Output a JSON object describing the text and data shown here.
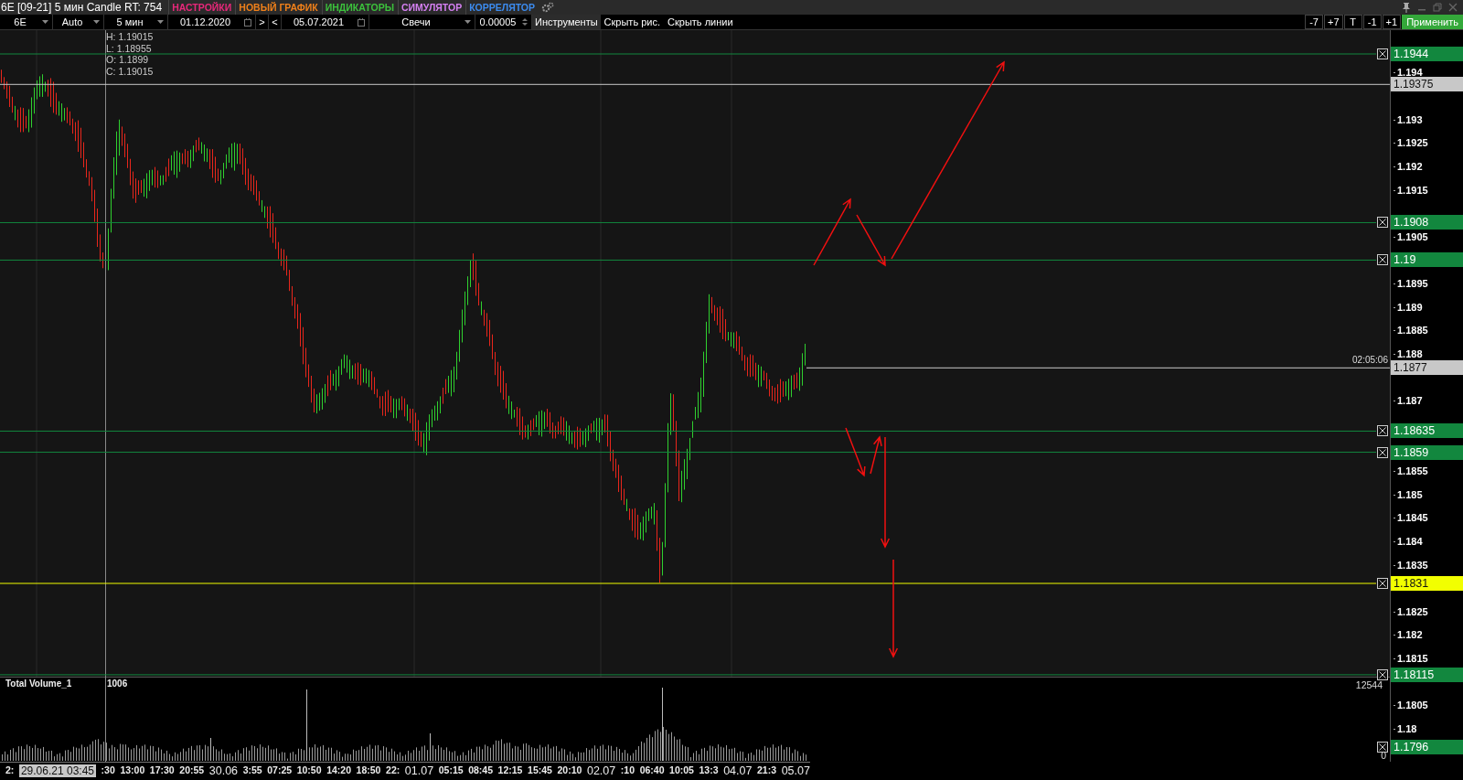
{
  "title_bar": {
    "title": "6E [09-21] 5 мин Candle RT: 754",
    "menu": [
      {
        "label": "НАСТРОЙКИ",
        "color": "#e8287a"
      },
      {
        "label": "НОВЫЙ ГРАФИК",
        "color": "#f0801a"
      },
      {
        "label": "ИНДИКАТОРЫ",
        "color": "#3cc23c"
      },
      {
        "label": "СИМУЛЯТОР",
        "color": "#d580f2"
      },
      {
        "label": "КОРРЕЛЯТОР",
        "color": "#3c8cf0"
      }
    ]
  },
  "toolbar": {
    "controls": [
      {
        "kind": "select",
        "value": "6E"
      },
      {
        "kind": "select",
        "value": "Auto"
      },
      {
        "kind": "select",
        "value": "5 мин"
      },
      {
        "kind": "date",
        "value": "01.12.2020"
      },
      {
        "kind": "button",
        "value": ">"
      },
      {
        "kind": "button",
        "value": "<"
      },
      {
        "kind": "date",
        "value": "05.07.2021"
      },
      {
        "kind": "select",
        "value": "Свечи"
      },
      {
        "kind": "spinner",
        "value": "0.00005"
      },
      {
        "kind": "tool",
        "value": "Инструменты"
      },
      {
        "kind": "link",
        "value": "Скрыть рис."
      },
      {
        "kind": "link",
        "value": "Скрыть линии"
      }
    ],
    "right_buttons": [
      {
        "label": "-7",
        "kind": "plain"
      },
      {
        "label": "+7",
        "kind": "plain"
      },
      {
        "label": "T",
        "kind": "plain"
      },
      {
        "label": "-1",
        "kind": "plain"
      },
      {
        "label": "+1",
        "kind": "plain"
      },
      {
        "label": "Применить",
        "kind": "apply"
      }
    ]
  },
  "chart": {
    "ohlc": [
      "H: 1.19015",
      "L: 1.18955",
      "O: 1.1899",
      "C: 1.19015"
    ],
    "levels": [
      {
        "price": "1.1944",
        "color": "#12873e",
        "closable": true
      },
      {
        "price": "1.19375",
        "color": "#c8c8c8",
        "closable": false
      },
      {
        "price": "1.1908",
        "color": "#12873e",
        "closable": true
      },
      {
        "price": "1.19",
        "color": "#12873e",
        "closable": true
      },
      {
        "price": "1.1877",
        "color": "#c8c8c8",
        "closable": false,
        "time": "02:05:06"
      },
      {
        "price": "1.18635",
        "color": "#12873e",
        "closable": true
      },
      {
        "price": "1.1859",
        "color": "#12873e",
        "closable": true
      },
      {
        "price": "1.1831",
        "color": "#f2ff00",
        "closable": true
      },
      {
        "price": "1.18115",
        "color": "#12873e",
        "closable": true
      },
      {
        "price": "1.1796",
        "color": "#12873e",
        "closable": true
      }
    ],
    "price_ticks": [
      "1.194",
      "1.193",
      "1.1925",
      "1.192",
      "1.1915",
      "1.1905",
      "1.1895",
      "1.189",
      "1.1885",
      "1.188",
      "1.187",
      "1.1855",
      "1.185",
      "1.1845",
      "1.184",
      "1.1835",
      "1.1825",
      "1.182",
      "1.1815",
      "1.1805",
      "1.18"
    ]
  },
  "volume_panel": {
    "title": "Total Volume_1",
    "cursor_value": "1006",
    "max_value": "12544",
    "min_value": "0"
  },
  "time_axis": [
    {
      "label": "2:",
      "kind": "time"
    },
    {
      "label": "29.06.21 03:45",
      "kind": "cursor"
    },
    {
      "label": ":30",
      "kind": "time"
    },
    {
      "label": "13:00",
      "kind": "time"
    },
    {
      "label": "17:30",
      "kind": "time"
    },
    {
      "label": "20:55",
      "kind": "time"
    },
    {
      "label": "30.06",
      "kind": "date"
    },
    {
      "label": "3:55",
      "kind": "time"
    },
    {
      "label": "07:25",
      "kind": "time"
    },
    {
      "label": "10:50",
      "kind": "time"
    },
    {
      "label": "14:20",
      "kind": "time"
    },
    {
      "label": "18:50",
      "kind": "time"
    },
    {
      "label": "22:",
      "kind": "time"
    },
    {
      "label": "01.07",
      "kind": "date"
    },
    {
      "label": "05:15",
      "kind": "time"
    },
    {
      "label": "08:45",
      "kind": "time"
    },
    {
      "label": "12:15",
      "kind": "time"
    },
    {
      "label": "15:45",
      "kind": "time"
    },
    {
      "label": "20:10",
      "kind": "time"
    },
    {
      "label": "02.07",
      "kind": "date"
    },
    {
      "label": ":10",
      "kind": "time"
    },
    {
      "label": "06:40",
      "kind": "time"
    },
    {
      "label": "10:05",
      "kind": "time"
    },
    {
      "label": "13:3",
      "kind": "time"
    },
    {
      "label": "04.07",
      "kind": "date"
    },
    {
      "label": "21:3",
      "kind": "time"
    },
    {
      "label": "05.07",
      "kind": "date"
    }
  ]
}
